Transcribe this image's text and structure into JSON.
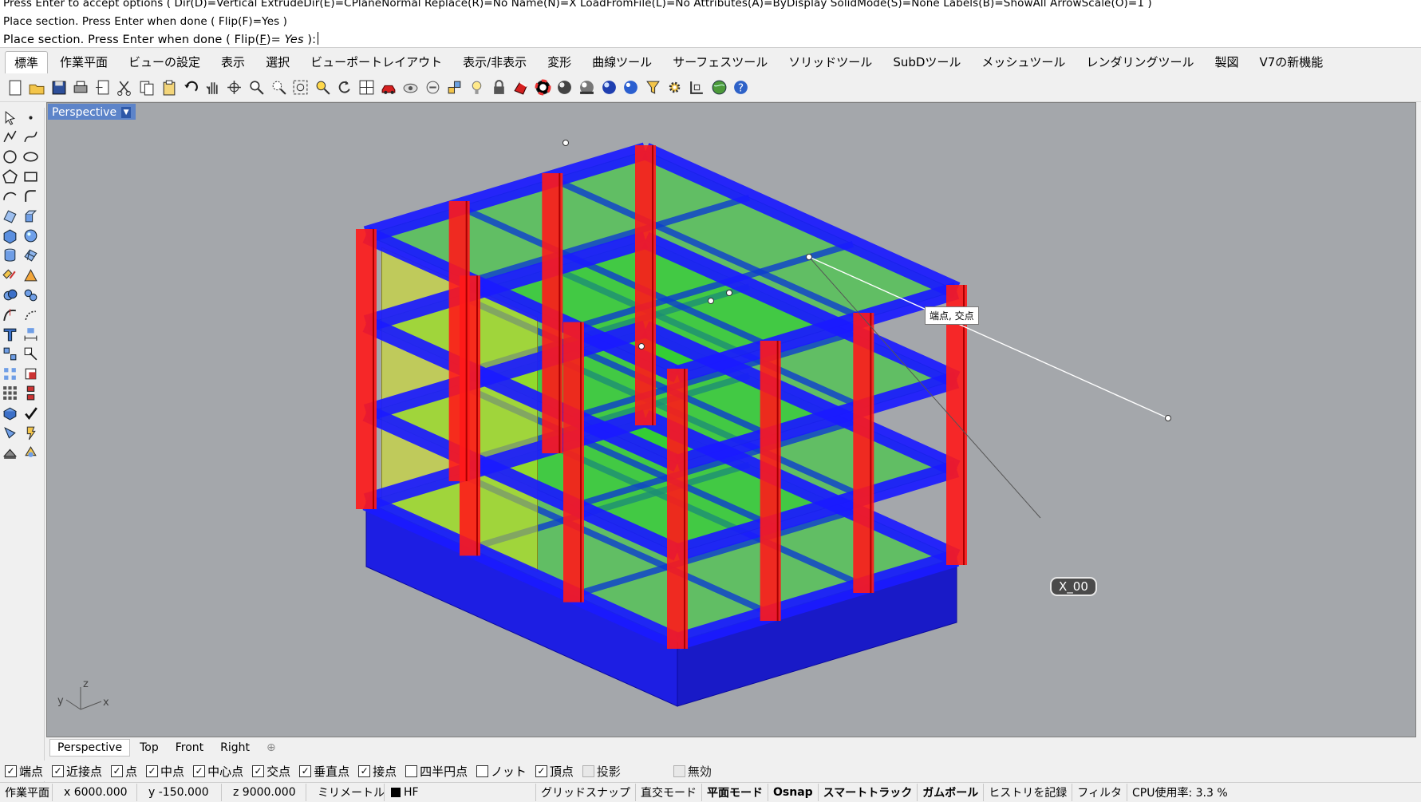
{
  "command": {
    "line1": "Press Enter to accept options ( Dir(D)=Vertical  ExtrudeDir(E)=CPlaneNormal  Replace(R)=No  Name(N)=X  LoadFromFile(L)=No  Attributes(A)=ByDisplay  SolidMode(S)=None  Labels(B)=ShowAll  ArrowScale(O)=1 )",
    "line2": "Place section. Press Enter when done ( Flip(F)=Yes )",
    "line3_prompt": "Place section. Press Enter when done ( Flip(",
    "line3_key": "F",
    "line3_eq": ")= ",
    "line3_value": "Yes",
    "line3_end": " ):"
  },
  "tabs": [
    "標準",
    "作業平面",
    "ビューの設定",
    "表示",
    "選択",
    "ビューポートレイアウト",
    "表示/非表示",
    "変形",
    "曲線ツール",
    "サーフェスツール",
    "ソリッドツール",
    "SubDツール",
    "メッシュツール",
    "レンダリングツール",
    "製図",
    "V7の新機能"
  ],
  "active_tab": "標準",
  "toolbar_icons": [
    "new-file-icon",
    "open-file-icon",
    "save-icon",
    "print-icon",
    "import-icon",
    "cut-icon",
    "copy-icon",
    "paste-icon",
    "undo-icon",
    "pan-icon",
    "rotate-view-icon",
    "zoom-icon",
    "zoom-window-icon",
    "zoom-extents-icon",
    "zoom-selected-icon",
    "undo-view-icon",
    "four-viewports-icon",
    "car-icon",
    "hide-icon",
    "show-icon",
    "point-edit-icon",
    "light-icon",
    "lock-icon",
    "material-icon",
    "color-wheel-icon",
    "shaded-sphere-icon",
    "rendered-sphere-icon",
    "render-icon",
    "sphere-blue-icon",
    "filter-icon",
    "options-gear-icon",
    "grid-snap-icon",
    "globe-icon",
    "help-icon"
  ],
  "viewport": {
    "title": "Perspective",
    "tooltip": "端点, 交点",
    "section_label": "X_00",
    "axes": {
      "x": "x",
      "y": "y",
      "z": "z"
    }
  },
  "viewport_tabs": [
    "Perspective",
    "Top",
    "Front",
    "Right"
  ],
  "viewport_tab_plus": "⊕",
  "osnaps": [
    {
      "label": "端点",
      "checked": "☑"
    },
    {
      "label": "近接点",
      "checked": "☑"
    },
    {
      "label": "点",
      "checked": "☑"
    },
    {
      "label": "中点",
      "checked": "☑"
    },
    {
      "label": "中心点",
      "checked": "☑"
    },
    {
      "label": "交点",
      "checked": "☑"
    },
    {
      "label": "垂直点",
      "checked": "☑"
    },
    {
      "label": "接点",
      "checked": "☑"
    },
    {
      "label": "四半円点",
      "checked": ""
    },
    {
      "label": "ノット",
      "checked": ""
    },
    {
      "label": "頂点",
      "checked": "☑"
    },
    {
      "label": "投影",
      "checked": ""
    }
  ],
  "osnap_disable": "無効",
  "status": {
    "cplane": "作業平面",
    "x": "x 6000.000",
    "y": "y -150.000",
    "z": "z 9000.000",
    "units": "ミリメートル",
    "layer": "HF",
    "grid_snap": "グリッドスナップ",
    "ortho": "直交モード",
    "planar": "平面モード",
    "osnap": "Osnap",
    "smarttrack": "スマートトラック",
    "gumball": "ガムボール",
    "history": "ヒストリを記録",
    "filter": "フィルタ",
    "cpu": "CPU使用率: 3.3 %"
  },
  "colors": {
    "column": "#ff1a1a",
    "beam": "#1a1aff",
    "slab": "#2ad22a",
    "wall": "#d6e81a",
    "viewport_bg": "#a4a7ab",
    "viewport_title": "#5d84c9"
  }
}
